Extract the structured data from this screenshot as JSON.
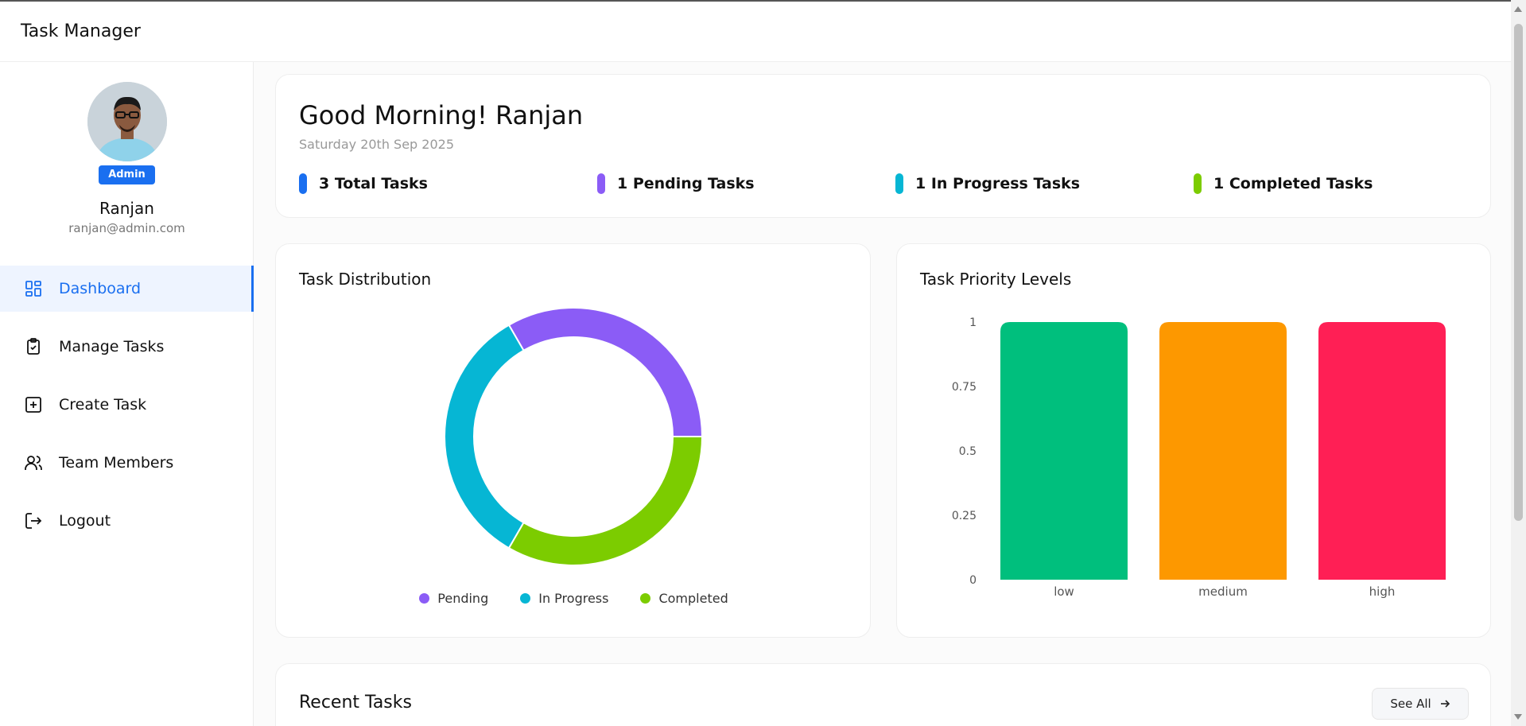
{
  "app": {
    "title": "Task Manager"
  },
  "profile": {
    "role": "Admin",
    "name": "Ranjan",
    "email": "ranjan@admin.com"
  },
  "menu": [
    {
      "label": "Dashboard",
      "icon": "dashboard-grid-icon",
      "active": true
    },
    {
      "label": "Manage Tasks",
      "icon": "clipboard-check-icon",
      "active": false
    },
    {
      "label": "Create Task",
      "icon": "plus-square-icon",
      "active": false
    },
    {
      "label": "Team Members",
      "icon": "users-icon",
      "active": false
    },
    {
      "label": "Logout",
      "icon": "logout-icon",
      "active": false
    }
  ],
  "greeting": {
    "title": "Good Morning! Ranjan",
    "date": "Saturday 20th Sep 2025"
  },
  "stats": [
    {
      "text": "3 Total Tasks",
      "color": "#1a6ff0"
    },
    {
      "text": "1 Pending Tasks",
      "color": "#8b5cf6"
    },
    {
      "text": "1 In Progress Tasks",
      "color": "#06b6d4"
    },
    {
      "text": "1 Completed Tasks",
      "color": "#7ccc00"
    }
  ],
  "distribution": {
    "title": "Task Distribution",
    "legend": [
      "Pending",
      "In Progress",
      "Completed"
    ]
  },
  "priority": {
    "title": "Task Priority Levels"
  },
  "recent": {
    "title": "Recent Tasks",
    "see_all_label": "See All"
  },
  "chart_data": [
    {
      "type": "pie",
      "title": "Task Distribution",
      "categories": [
        "Pending",
        "In Progress",
        "Completed"
      ],
      "values": [
        1,
        1,
        1
      ],
      "colors": [
        "#8b5cf6",
        "#06b6d4",
        "#7ccc00"
      ],
      "legend": "bottom"
    },
    {
      "type": "bar",
      "title": "Task Priority Levels",
      "categories": [
        "low",
        "medium",
        "high"
      ],
      "values": [
        1,
        1,
        1
      ],
      "colors": [
        "#00bf7d",
        "#fd9800",
        "#ff1f55"
      ],
      "ylim": [
        0,
        1
      ],
      "yticks": [
        "0",
        "0.25",
        "0.5",
        "0.75",
        "1"
      ]
    }
  ]
}
